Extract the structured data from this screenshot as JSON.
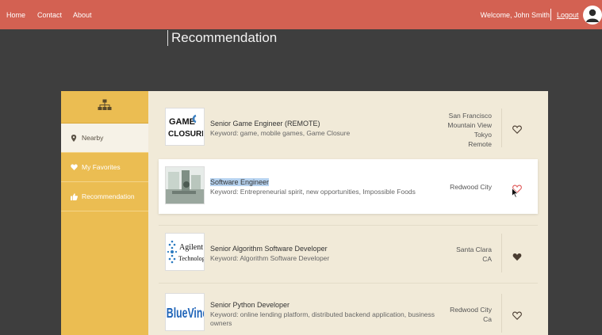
{
  "nav": {
    "home": "Home",
    "contact": "Contact",
    "about": "About"
  },
  "user": {
    "welcome": "Welcome, John Smith",
    "logout": "Logout"
  },
  "page": {
    "title": "Recommendation"
  },
  "sidebar": {
    "items": [
      {
        "label": "Nearby",
        "icon": "map-pin-icon",
        "active": true
      },
      {
        "label": "My Favorites",
        "icon": "heart-icon",
        "active": false
      },
      {
        "label": "Recommendation",
        "icon": "thumbs-up-icon",
        "active": false
      }
    ]
  },
  "jobs": [
    {
      "title": "Senior Game Engineer (REMOTE)",
      "keywords": "Keyword: game, mobile games, Game Closure",
      "location": [
        "San Francisco",
        "Mountain View",
        "Tokyo",
        "Remote"
      ],
      "logo": "GAME CLOSURE",
      "favorite": false
    },
    {
      "title": "Software Engineer",
      "keywords": "Keyword: Entrepreneurial spirit, new opportunities, Impossible Foods",
      "location": [
        "Redwood City"
      ],
      "logo": "",
      "favorite": false
    },
    {
      "title": "Senior Algorithm Software Developer",
      "keywords": "Keyword: Algorithm Software Developer",
      "location": [
        "Santa Clara",
        "CA"
      ],
      "logo": "Agilent Technologies",
      "favorite": true
    },
    {
      "title": "Senior Python Developer",
      "keywords": "Keyword: online lending platform, distributed backend application, business owners",
      "location": [
        "Redwood City",
        "Ca"
      ],
      "logo": "BlueVine",
      "favorite": false
    }
  ],
  "colors": {
    "topbar": "#d36152",
    "sidebar": "#ebbd52",
    "panel": "#f1ead8",
    "background": "#3e3e3e",
    "heart_active": "#e05a5a"
  }
}
